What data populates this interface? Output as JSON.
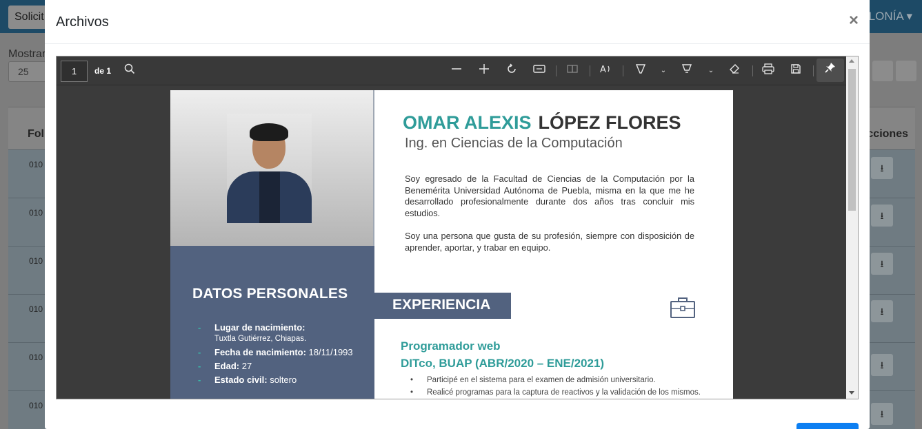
{
  "background": {
    "nav_button_label": "Solicit",
    "nav_right_label": "LONÍA",
    "mostrar_label": "Mostrar",
    "page_size_value": "25",
    "table_col_first": "Fol",
    "table_col_last": "cciones",
    "row_prefixes": [
      "010",
      "010",
      "010",
      "010",
      "010",
      "010"
    ]
  },
  "modal": {
    "title": "Archivos",
    "close_label": "×"
  },
  "viewer": {
    "page_number": "1",
    "page_of": "de 1",
    "icons": [
      "search-icon",
      "zoom-out-icon",
      "zoom-in-icon",
      "rotate-icon",
      "fit-width-icon",
      "page-view-icon",
      "read-aloud-icon",
      "highlight-icon",
      "draw-icon",
      "eraser-icon",
      "print-icon",
      "save-icon",
      "pin-icon"
    ]
  },
  "document": {
    "first_name": "OMAR ALEXIS",
    "last_name": "LÓPEZ FLORES",
    "subtitle": "Ing. en Ciencias de la Computación",
    "para1": "Soy egresado de la Facultad de Ciencias de la Computación por la Benemérita Universidad Autónoma de Puebla, misma en la que me he desarrollado profesionalmente durante dos años tras concluir mis estudios.",
    "para2": "Soy una persona que gusta de su profesión, siempre con disposición de aprender, aportar, y trabar en equipo.",
    "datos_title": "DATOS PERSONALES",
    "datos": [
      {
        "label": "Lugar de nacimiento:",
        "value": "Tuxtla Gutiérrez, Chiapas."
      },
      {
        "label": "Fecha de nacimiento:",
        "value": "18/11/1993"
      },
      {
        "label": "Edad:",
        "value": "27"
      },
      {
        "label": "Estado civil:",
        "value": "soltero"
      }
    ],
    "experiencia_title": "EXPERIENCIA",
    "job_title": "Programador web",
    "job_company": "DITco, BUAP (ABR/2020 – ENE/2021)",
    "bullets": [
      "Participé en el sistema para el examen de admisión universitario.",
      "Realicé programas para la captura de reactivos y la validación de los mismos."
    ],
    "accent_color": "#2f9c99",
    "panel_color": "#52627f"
  }
}
